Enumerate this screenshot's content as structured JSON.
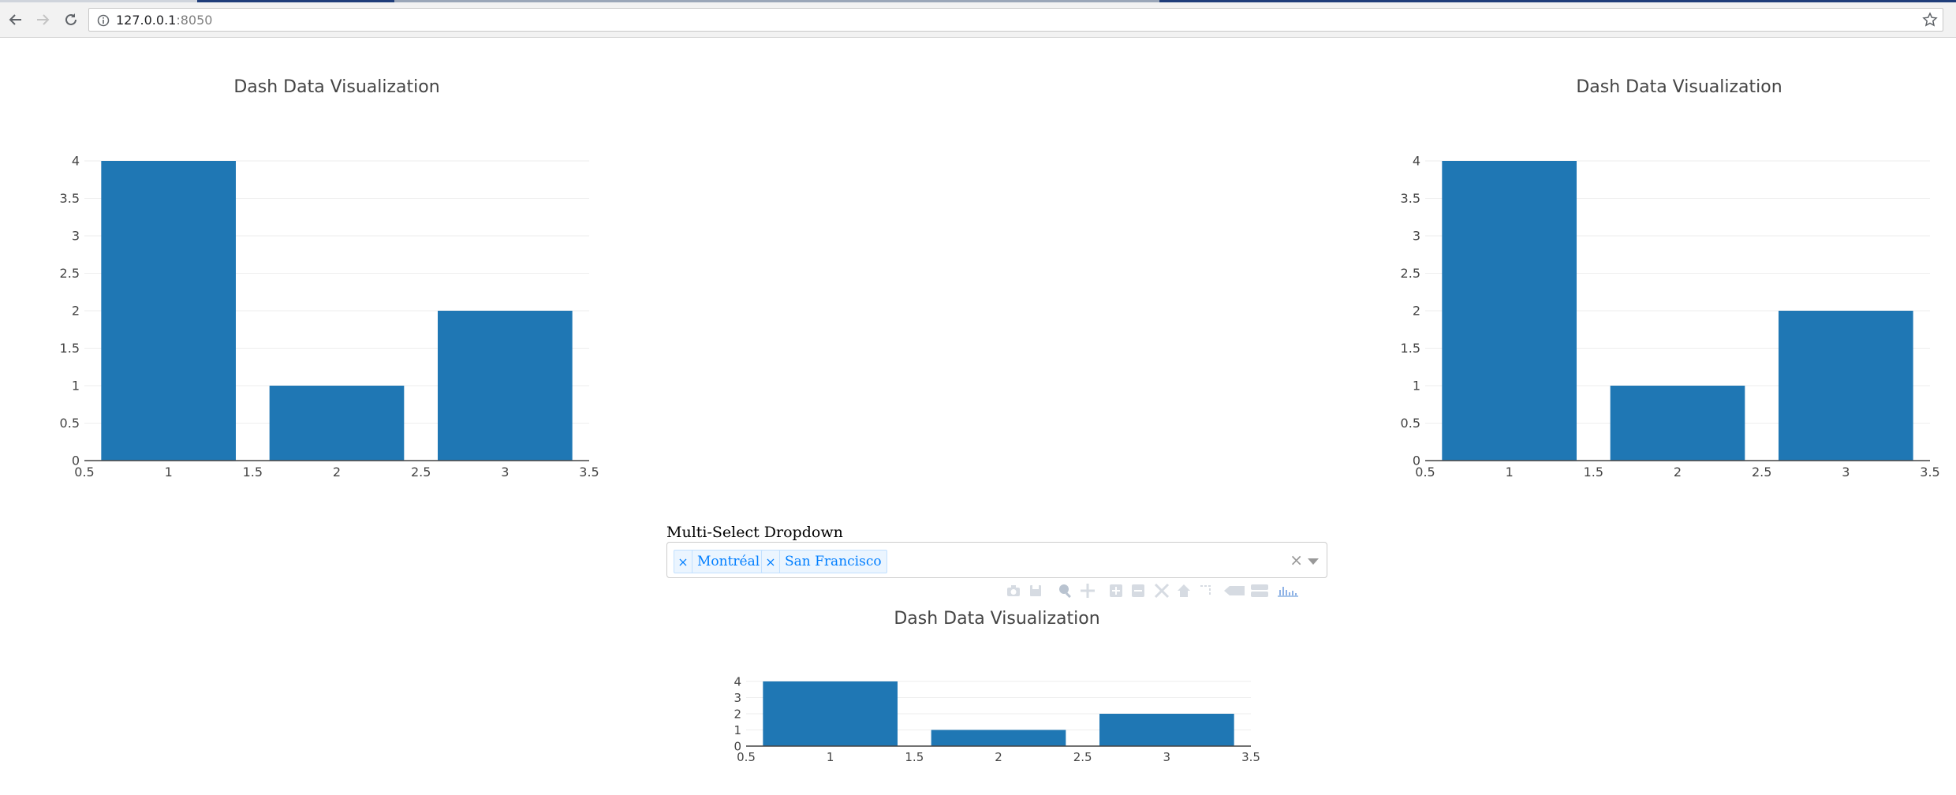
{
  "browser": {
    "url_host": "127.0.0.1",
    "url_port": ":8050"
  },
  "charts": [
    {
      "title": "Dash Data Visualization",
      "chart_data": {
        "type": "bar",
        "x": [
          1,
          2,
          3
        ],
        "values": [
          4,
          1,
          2
        ],
        "xlim": [
          0.5,
          3.5
        ],
        "ylim": [
          0,
          4
        ],
        "xticks": [
          "0.5",
          "1",
          "1.5",
          "2",
          "2.5",
          "3",
          "3.5"
        ],
        "yticks": [
          "0",
          "0.5",
          "1",
          "1.5",
          "2",
          "2.5",
          "3",
          "3.5",
          "4"
        ],
        "bar_color": "#1f77b4",
        "grid": true
      }
    },
    {
      "title": "Dash Data Visualization",
      "chart_data": {
        "type": "bar",
        "x": [
          1,
          2,
          3
        ],
        "values": [
          4,
          1,
          2
        ],
        "xlim": [
          0.5,
          3.5
        ],
        "ylim": [
          0,
          4
        ],
        "xticks": [
          "0.5",
          "1",
          "1.5",
          "2",
          "2.5",
          "3",
          "3.5"
        ],
        "yticks": [
          "0",
          "0.5",
          "1",
          "1.5",
          "2",
          "2.5",
          "3",
          "3.5",
          "4"
        ],
        "bar_color": "#1f77b4",
        "grid": true
      }
    },
    {
      "title": "Dash Data Visualization",
      "chart_data": {
        "type": "bar",
        "x": [
          1,
          2,
          3
        ],
        "values": [
          4,
          1,
          2
        ],
        "xlim": [
          0.5,
          3.5
        ],
        "ylim": [
          0,
          4
        ],
        "xticks": [
          "0.5",
          "1",
          "1.5",
          "2",
          "2.5",
          "3",
          "3.5"
        ],
        "yticks": [
          "0",
          "1",
          "2",
          "3",
          "4"
        ],
        "bar_color": "#1f77b4",
        "grid": true
      }
    }
  ],
  "dropdown": {
    "label": "Multi-Select Dropdown",
    "selected": [
      "Montréal",
      "San Francisco"
    ],
    "remove_glyph": "×",
    "clear_glyph": "×"
  },
  "modebar_icons": [
    "camera-icon",
    "save-icon",
    "zoom-icon",
    "pan-icon",
    "zoom-in-icon",
    "zoom-out-icon",
    "autoscale-icon",
    "home-icon",
    "spike-lines-icon",
    "hover-closest-icon",
    "hover-compare-icon",
    "plotly-logo-icon"
  ]
}
